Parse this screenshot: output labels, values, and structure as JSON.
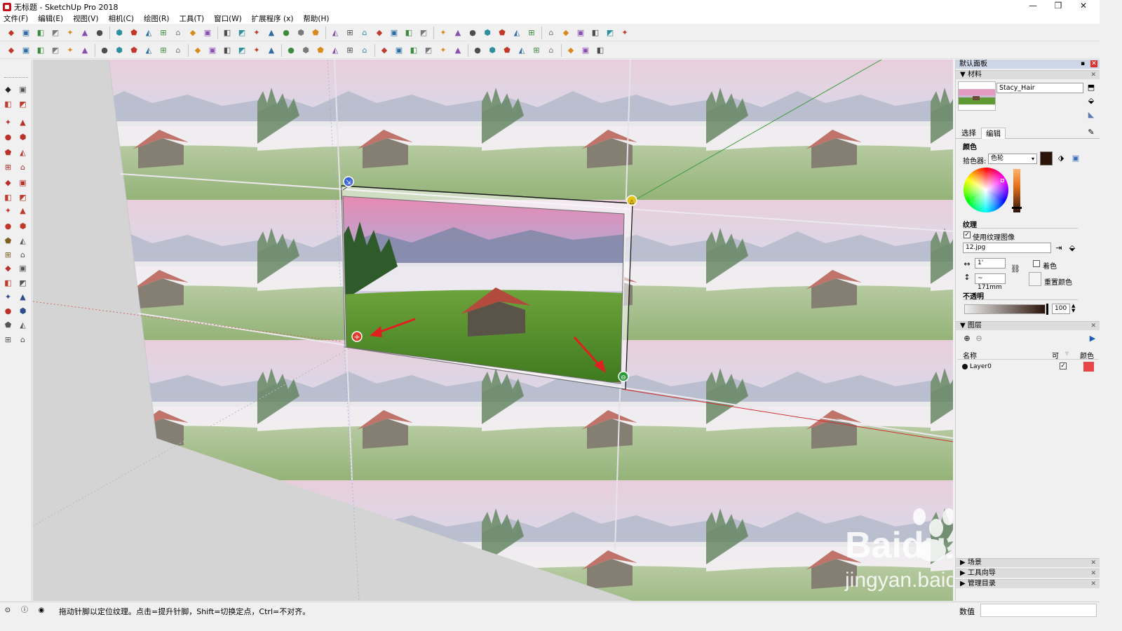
{
  "window": {
    "title": "无标题 - SketchUp Pro 2018",
    "controls": {
      "minimize": "—",
      "maximize": "❐",
      "close": "✕"
    }
  },
  "menu": [
    "文件(F)",
    "编辑(E)",
    "视图(V)",
    "相机(C)",
    "绘图(R)",
    "工具(T)",
    "窗口(W)",
    "扩展程序 (x)",
    "帮助(H)"
  ],
  "toolbar": {
    "row1_icons": [
      "paint-bucket-icon",
      "select-icon",
      "play-icon",
      "orbit-icon",
      "pan-icon",
      "iso-view-icon",
      "top-view-icon",
      "front-view-icon",
      "right-view-icon",
      "back-view-icon",
      "left-view-icon",
      "xray-icon",
      "wireframe-icon",
      "hidden-line-icon",
      "shaded-icon",
      "textured-icon",
      "monochrome-icon",
      "edge-icon",
      "profile-icon",
      "depth-icon",
      "extension-icon",
      "section-icon",
      "fog-icon",
      "shadow-icon",
      "sun-icon",
      "warehouse-icon",
      "share-icon",
      "render-icon",
      "layout-icon",
      "style-icon",
      "scene-icon",
      "tag-icon",
      "light-icon",
      "camera-icon",
      "export-icon",
      "report-icon",
      "doc-icon",
      "expand-icon",
      "map-icon",
      "globe-icon",
      "earth-icon"
    ],
    "row2_icons": [
      "axes-icon",
      "box-icon",
      "home-icon",
      "building-icon",
      "component-icon",
      "face-icon",
      "paint-icon",
      "push-icon",
      "shape-icon",
      "solid-icon",
      "layer-icon",
      "material-icon",
      "group-icon",
      "outer-shell-icon",
      "intersect-icon",
      "union-icon",
      "subtract-icon",
      "trim-icon",
      "split-icon",
      "sandbox-icon",
      "smoove-icon",
      "stamp-icon",
      "drape-icon",
      "add-detail-icon",
      "flip-edge-icon",
      "move-icon",
      "orbit-view-icon",
      "walk-icon",
      "look-icon",
      "position-icon",
      "advanced-camera-icon",
      "section-plane-icon",
      "display-section-icon",
      "section-cut-icon",
      "dimension-icon",
      "photo-icon",
      "text-icon",
      "cloud-icon",
      "refresh-icon"
    ]
  },
  "tray": {
    "title": "默认面板",
    "materials_section": "材料",
    "material_name": "Stacy_Hair",
    "tabs": {
      "select": "选择",
      "edit": "编辑"
    },
    "color_label": "颜色",
    "picker_label": "拾色器:",
    "picker_value": "色轮",
    "current_color": "#2b140a",
    "texture_label": "纹理",
    "use_texture_label": "使用纹理图像",
    "use_texture_checked": "✓",
    "texture_file": "12.jpg",
    "width_value": "1'",
    "height_value": "~ 171mm",
    "colorize_label": "着色",
    "reset_color_label": "重置颜色",
    "opacity_label": "不透明",
    "opacity_value": "100",
    "layers_section": "图层",
    "layers_header": {
      "name": "名称",
      "visible": "可",
      "color": "颜色"
    },
    "layer0": {
      "name": "Layer0",
      "visible_mark": "✓",
      "color": "#e8474a"
    },
    "scenes_section": "场景",
    "instructor_section": "工具向导",
    "outliner_section": "管理目录"
  },
  "status": {
    "text": "拖动针脚以定位纹理。点击=提升针脚，Shift=切换定点，Ctrl=不对齐。",
    "measurement_label": "数值"
  },
  "watermark": {
    "brand": "Baidu经验",
    "url": "jingyan.baidu.com"
  },
  "viewport": {
    "pins": [
      {
        "name": "blue-pin",
        "color": "#3b63d8",
        "symbol": "⇲"
      },
      {
        "name": "yellow-pin",
        "color": "#e3c11a",
        "symbol": "△"
      },
      {
        "name": "red-pin",
        "color": "#e23a2a",
        "symbol": "✛"
      },
      {
        "name": "green-pin",
        "color": "#2a9a3a",
        "symbol": "⊖"
      }
    ],
    "arrow_color": "#e02020"
  }
}
